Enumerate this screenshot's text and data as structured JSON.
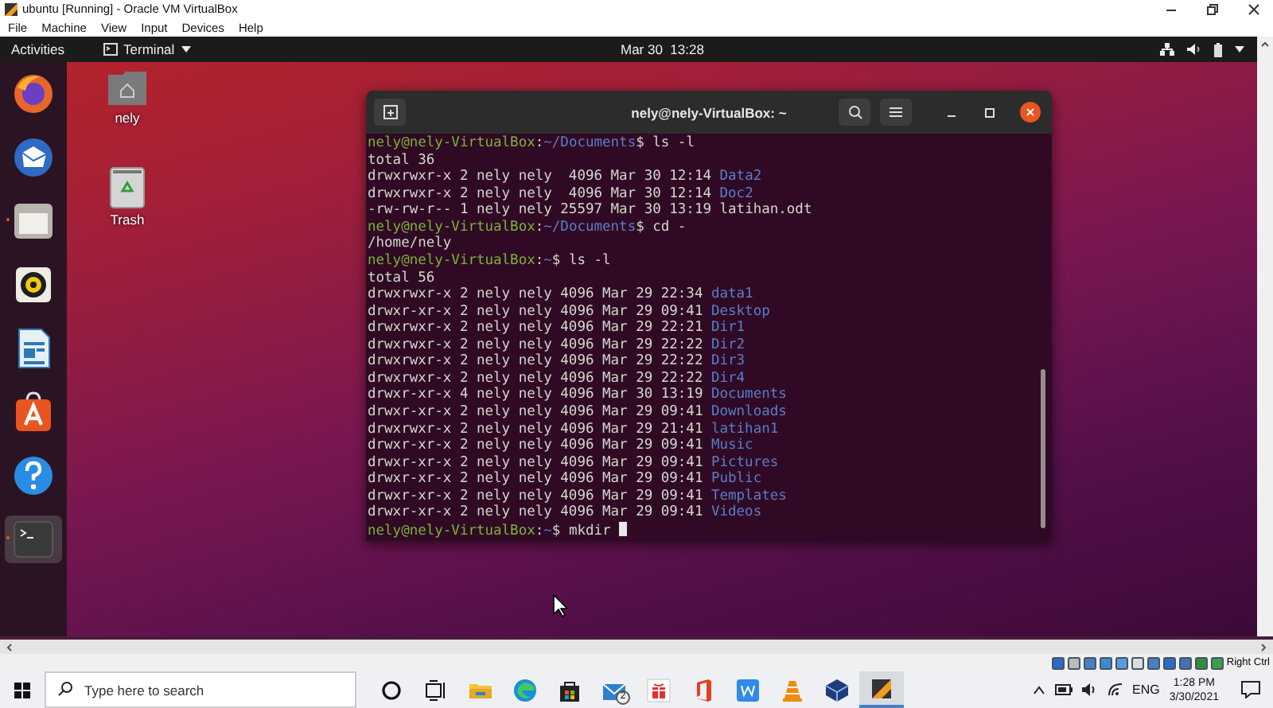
{
  "vbox": {
    "title": "ubuntu [Running] - Oracle VM VirtualBox",
    "menu": [
      "File",
      "Machine",
      "View",
      "Input",
      "Devices",
      "Help"
    ],
    "host_key": "Right Ctrl"
  },
  "topbar": {
    "activities": "Activities",
    "app_menu": "Terminal",
    "clock": "Mar 30  13:28"
  },
  "dock": [
    {
      "kind": "firefox",
      "running": false,
      "selected": false
    },
    {
      "kind": "mail",
      "running": false,
      "selected": false
    },
    {
      "kind": "files",
      "running": true,
      "selected": false
    },
    {
      "kind": "speaker",
      "running": false,
      "selected": false
    },
    {
      "kind": "writer",
      "running": false,
      "selected": false
    },
    {
      "kind": "software",
      "running": false,
      "selected": false
    },
    {
      "kind": "help",
      "running": false,
      "selected": false
    },
    {
      "kind": "terminal",
      "running": true,
      "selected": true
    }
  ],
  "desktop_icons": [
    {
      "kind": "home",
      "label": "nely"
    },
    {
      "kind": "trash",
      "label": "Trash"
    }
  ],
  "terminal": {
    "title": "nely@nely-VirtualBox: ~",
    "lines": [
      {
        "kind": "prompt",
        "host": "nely@nely-VirtualBox",
        "sep": ":",
        "path": "~/Documents",
        "command": "$ ls -l",
        "cursor": false
      },
      {
        "kind": "output",
        "text": "total 36"
      },
      {
        "kind": "entry",
        "info": "drwxrwxr-x 2 nely nely  4096 Mar 30 12:14",
        "name": "Data2",
        "directory": true
      },
      {
        "kind": "entry",
        "info": "drwxrwxr-x 2 nely nely  4096 Mar 30 12:14",
        "name": "Doc2",
        "directory": true
      },
      {
        "kind": "entry",
        "info": "-rw-rw-r-- 1 nely nely 25597 Mar 30 13:19",
        "name": "latihan.odt",
        "directory": false
      },
      {
        "kind": "prompt",
        "host": "nely@nely-VirtualBox",
        "sep": ":",
        "path": "~/Documents",
        "command": "$ cd -",
        "cursor": false
      },
      {
        "kind": "output",
        "text": "/home/nely"
      },
      {
        "kind": "prompt",
        "host": "nely@nely-VirtualBox",
        "sep": ":",
        "path": "~",
        "command": "$ ls -l",
        "cursor": false
      },
      {
        "kind": "output",
        "text": "total 56"
      },
      {
        "kind": "entry",
        "info": "drwxrwxr-x 2 nely nely 4096 Mar 29 22:34",
        "name": "data1",
        "directory": true
      },
      {
        "kind": "entry",
        "info": "drwxr-xr-x 2 nely nely 4096 Mar 29 09:41",
        "name": "Desktop",
        "directory": true
      },
      {
        "kind": "entry",
        "info": "drwxrwxr-x 2 nely nely 4096 Mar 29 22:21",
        "name": "Dir1",
        "directory": true
      },
      {
        "kind": "entry",
        "info": "drwxrwxr-x 2 nely nely 4096 Mar 29 22:22",
        "name": "Dir2",
        "directory": true
      },
      {
        "kind": "entry",
        "info": "drwxrwxr-x 2 nely nely 4096 Mar 29 22:22",
        "name": "Dir3",
        "directory": true
      },
      {
        "kind": "entry",
        "info": "drwxrwxr-x 2 nely nely 4096 Mar 29 22:22",
        "name": "Dir4",
        "directory": true
      },
      {
        "kind": "entry",
        "info": "drwxr-xr-x 4 nely nely 4096 Mar 30 13:19",
        "name": "Documents",
        "directory": true
      },
      {
        "kind": "entry",
        "info": "drwxr-xr-x 2 nely nely 4096 Mar 29 09:41",
        "name": "Downloads",
        "directory": true
      },
      {
        "kind": "entry",
        "info": "drwxrwxr-x 2 nely nely 4096 Mar 29 21:41",
        "name": "latihan1",
        "directory": true
      },
      {
        "kind": "entry",
        "info": "drwxr-xr-x 2 nely nely 4096 Mar 29 09:41",
        "name": "Music",
        "directory": true
      },
      {
        "kind": "entry",
        "info": "drwxr-xr-x 2 nely nely 4096 Mar 29 09:41",
        "name": "Pictures",
        "directory": true
      },
      {
        "kind": "entry",
        "info": "drwxr-xr-x 2 nely nely 4096 Mar 29 09:41",
        "name": "Public",
        "directory": true
      },
      {
        "kind": "entry",
        "info": "drwxr-xr-x 2 nely nely 4096 Mar 29 09:41",
        "name": "Templates",
        "directory": true
      },
      {
        "kind": "entry",
        "info": "drwxr-xr-x 2 nely nely 4096 Mar 29 09:41",
        "name": "Videos",
        "directory": true
      },
      {
        "kind": "prompt",
        "host": "nely@nely-VirtualBox",
        "sep": ":",
        "path": "~",
        "command": "$ mkdir",
        "cursor": true
      }
    ]
  },
  "taskbar": {
    "search": {
      "placeholder": "Type here to search"
    },
    "apps": [
      {
        "kind": "cortana",
        "selected": false
      },
      {
        "kind": "taskview",
        "selected": false
      },
      {
        "kind": "explorer",
        "selected": false
      },
      {
        "kind": "edge",
        "selected": false
      },
      {
        "kind": "store",
        "selected": false
      },
      {
        "kind": "mail",
        "badge": "2",
        "selected": false
      },
      {
        "kind": "gift",
        "selected": false
      },
      {
        "kind": "office",
        "selected": false
      },
      {
        "kind": "wps",
        "selected": false
      },
      {
        "kind": "vlc",
        "selected": false
      },
      {
        "kind": "virtualbox",
        "selected": false
      },
      {
        "kind": "vm",
        "selected": true
      }
    ],
    "language": "ENG",
    "time": "1:28 PM",
    "date": "3/30/2021"
  }
}
